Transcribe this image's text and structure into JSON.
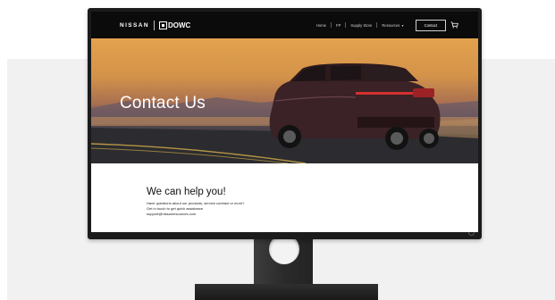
{
  "site": {
    "brand_primary": "NISSAN",
    "brand_secondary": "DOWC"
  },
  "nav": {
    "links": [
      "Home",
      "FP",
      "Supply Store",
      "Resources"
    ],
    "contact_label": "Contact",
    "icons": [
      "chevron-down-icon",
      "cart-icon"
    ]
  },
  "hero": {
    "title": "Contact Us"
  },
  "content": {
    "heading": "We can help you!",
    "lines": [
      "Have questions about our products, service contract or more?",
      "Get in touch to get quick assistance"
    ],
    "email": "support@nissanresources.com"
  },
  "colors": {
    "nav_bg": "#0b0b0b",
    "bezel": "#1b1b1b",
    "backdrop": "#f1f1f1"
  }
}
